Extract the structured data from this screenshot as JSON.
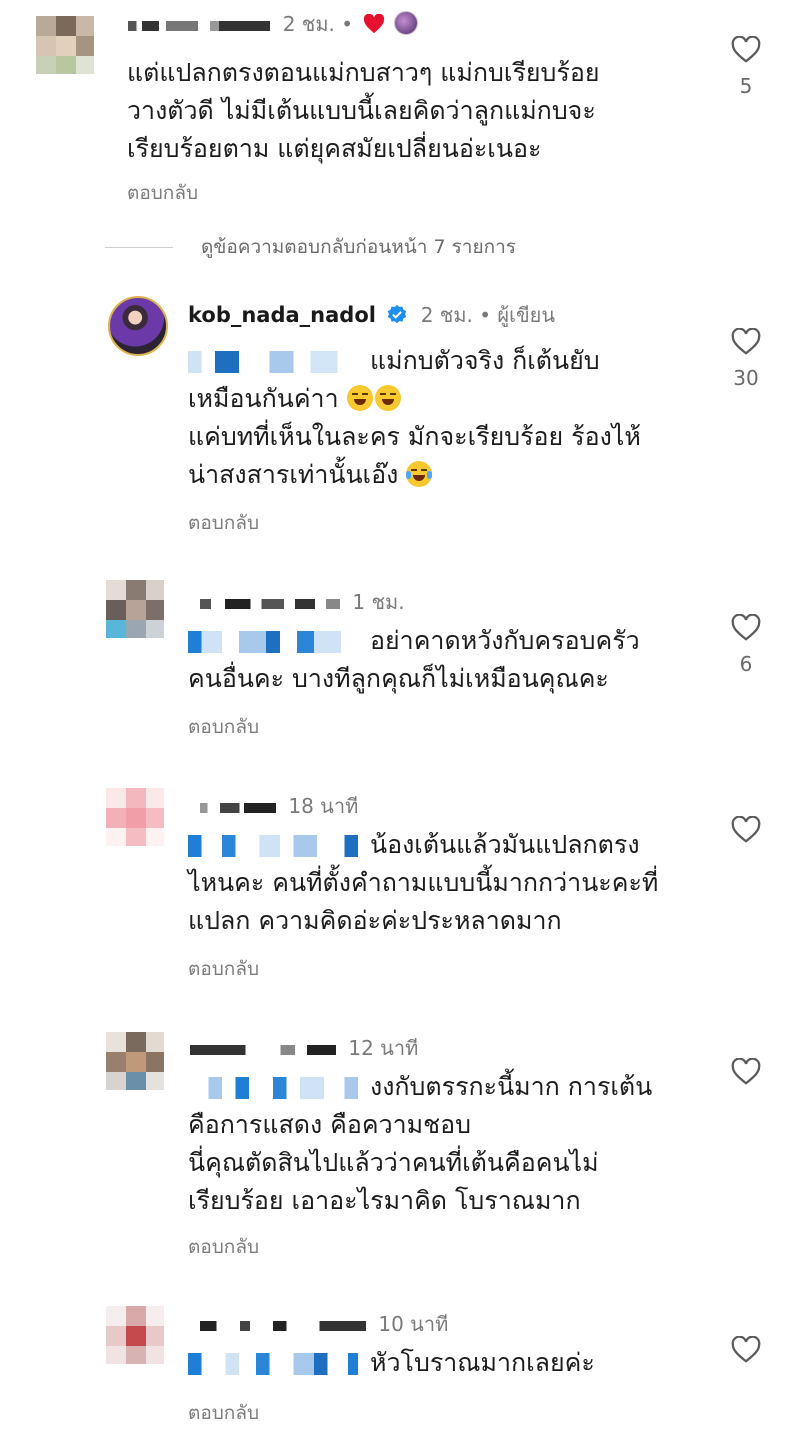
{
  "view_previous_replies": "ดูข้อความตอบกลับก่อนหน้า 7 รายการ",
  "reply_label": "ตอบกลับ",
  "like_icon": "heart-outline-icon",
  "comments": [
    {
      "id": "c1",
      "time": "2 ชม.",
      "lines": [
        "แต่แปลกตรงตอนแม่กบสาวๆ  แม่กบเรียบร้อย",
        "วางตัวดี  ไม่มีเต้นแบบนี้เลยคิดว่าลูกแม่กบจะ",
        "เรียบร้อยตาม แต่ยุคสมัยเปลี่ยนอ่ะเนอะ"
      ],
      "likes": "5",
      "creator_liked": true
    },
    {
      "id": "c2",
      "username": "kob_nada_nadol",
      "time": "2 ชม.",
      "author_label": "ผู้เขียน",
      "verified": true,
      "lines": [
        "แม่กบตัวจริง ก็เต้นยับ",
        "เหมือนกันค่าา",
        "แค่บทที่เห็นในละคร มักจะเรียบร้อย ร้องไห้",
        "น่าสงสารเท่านั้นเอ๊ง"
      ],
      "likes": "30"
    },
    {
      "id": "c3",
      "time": "1 ชม.",
      "lines": [
        "อย่าคาดหวังกับครอบครัว",
        "คนอื่นคะ บางทีลูกคุณก็ไม่เหมือนคุณคะ"
      ],
      "likes": "6"
    },
    {
      "id": "c4",
      "time": "18 นาที",
      "lines": [
        "น้องเต้นแล้วมันแปลกตรง",
        "ไหนคะ คนที่ตั้งคำถามแบบนี้มากกว่านะคะที่",
        "แปลก ความคิดอ่ะค่ะประหลาดมาก"
      ],
      "likes": ""
    },
    {
      "id": "c5",
      "time": "12 นาที",
      "lines": [
        "งงกับตรรกะนี้มาก  การเต้น",
        "คือการแสดง คือความชอบ",
        "นี่คุณตัดสินไปแล้วว่าคนที่เต้นคือคนไม่",
        "เรียบร้อย เอาอะไรมาคิด โบราณมาก"
      ],
      "likes": ""
    },
    {
      "id": "c6",
      "time": "10 นาที",
      "lines": [
        "หัวโบราณมากเลยค่ะ"
      ],
      "likes": ""
    }
  ],
  "colors": {
    "text": "#1c1c1c",
    "muted": "#7a7a7a",
    "heart_red": "#e8112d",
    "verified_blue": "#1d8ff0",
    "mention_blue": "#1f7fd6"
  }
}
